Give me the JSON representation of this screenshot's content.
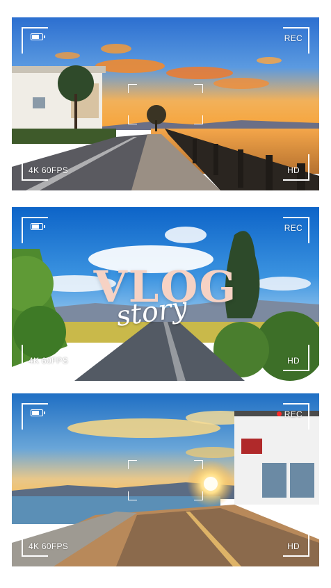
{
  "frames": [
    {
      "id": "frame-1",
      "rec_label": "REC",
      "recording": false,
      "fps_label": "4K 60FPS",
      "quality_label": "HD"
    },
    {
      "id": "frame-2",
      "rec_label": "REC",
      "recording": false,
      "fps_label": "4K 60FPS",
      "quality_label": "HD",
      "title": "VLOG",
      "subtitle": "story"
    },
    {
      "id": "frame-3",
      "rec_label": "REC",
      "recording": true,
      "fps_label": "4K 60FPS",
      "quality_label": "HD"
    }
  ],
  "colors": {
    "hud": "#ffffff",
    "rec_dot": "#ff2a2a",
    "title": "#f6d2c4"
  }
}
